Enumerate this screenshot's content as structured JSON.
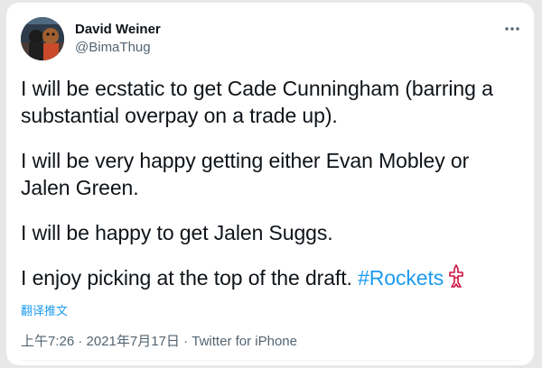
{
  "tweet": {
    "author": {
      "display_name": "David Weiner",
      "handle": "@BimaThug"
    },
    "more_icon": "ellipsis-icon",
    "paragraphs": [
      "I will be ecstatic to get Cade Cunningham (barring a substantial overpay on a trade up).",
      "I will be very happy getting either Evan Mobley or Jalen Green.",
      "I will be happy to get Jalen Suggs."
    ],
    "last_line": {
      "text": "I enjoy picking at the top of the draft. ",
      "hashtag": "#Rockets",
      "emoji_icon": "rockets-logo-icon"
    },
    "translate_label": "翻译推文",
    "timestamp": "上午7:26 · 2021年7月17日 · ",
    "source": "Twitter for iPhone"
  },
  "colors": {
    "text": "#0f1419",
    "secondary": "#536471",
    "link": "#1d9bf0",
    "rockets_red": "#ce1141"
  }
}
